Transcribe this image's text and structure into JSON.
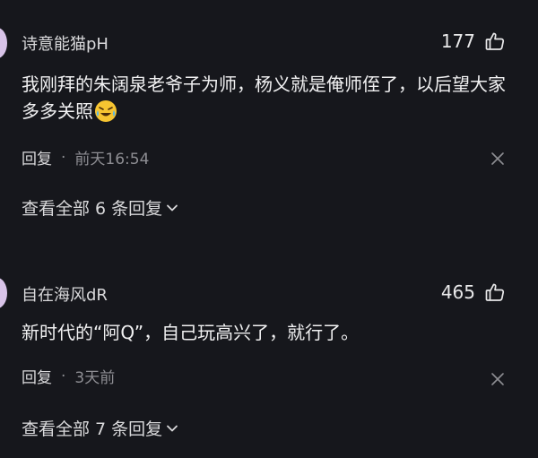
{
  "comments": [
    {
      "username": "诗意能猫pH",
      "likes": "177",
      "text": "我刚拜的朱阔泉老爷子为师，杨义就是俺师侄了，以后望大家多多关照",
      "emoji": "laughing-crying-emoji",
      "reply_label": "回复",
      "dot": "·",
      "time": "前天16:54",
      "view_replies": "查看全部 6 条回复"
    },
    {
      "username": "自在海风dR",
      "likes": "465",
      "text": "新时代的“阿Q”，自己玩高兴了，就行了。",
      "reply_label": "回复",
      "dot": "·",
      "time": "3天前",
      "view_replies": "查看全部 7 条回复"
    }
  ],
  "colors": {
    "background": "#16171c",
    "text_primary": "#f1f1f2",
    "text_secondary": "#8e8e93",
    "avatar_stub": "#d8c3e8"
  }
}
